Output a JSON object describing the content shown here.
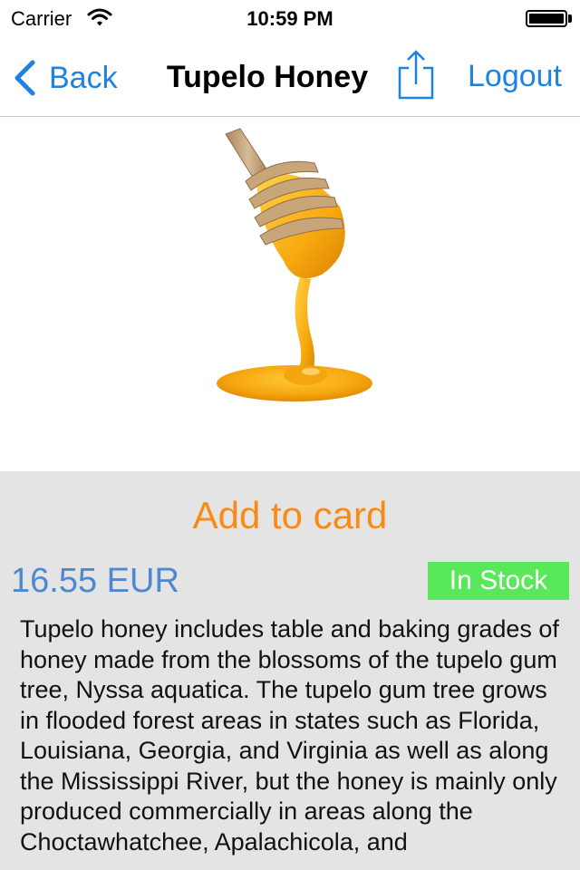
{
  "status_bar": {
    "carrier": "Carrier",
    "time": "10:59 PM",
    "battery_level": 1.0
  },
  "nav": {
    "back_label": "Back",
    "title": "Tupelo Honey",
    "logout_label": "Logout",
    "share_icon": "share-icon",
    "back_icon": "chevron-left-icon",
    "tint_color": "#1e82e0"
  },
  "product": {
    "image_subject": "honey-dipper-image",
    "add_to_cart_label": "Add to card",
    "price": "16.55 EUR",
    "stock_status": "In Stock",
    "description": "Tupelo honey includes table and baking grades of honey made from the blossoms of the tupelo gum tree, Nyssa aquatica. The tupelo gum tree grows in flooded forest areas in states such as Florida, Louisiana, Georgia, and Virginia as well as along the Mississippi River, but the honey is mainly only produced commercially in areas along the Choctawhatchee, Apalachicola, and",
    "colors": {
      "add_to_cart": "#f98a16",
      "price": "#4d88d3",
      "stock_badge": "#59e85a",
      "panel_background": "#e4e4e4"
    }
  }
}
